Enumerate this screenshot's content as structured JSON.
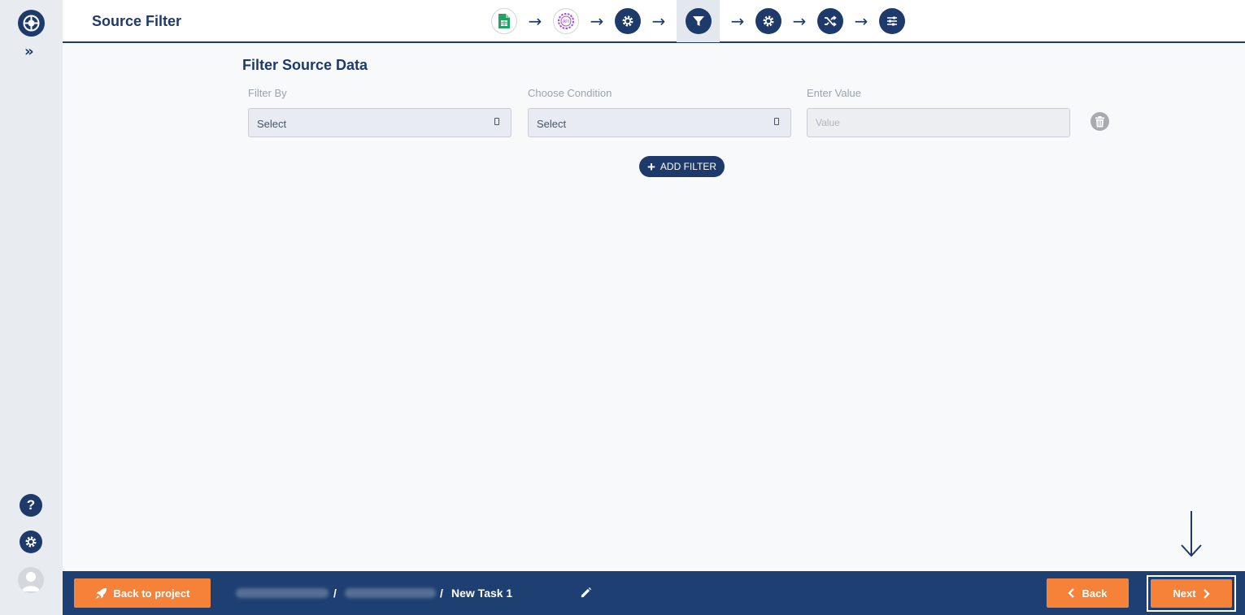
{
  "header": {
    "title": "Source Filter"
  },
  "stepper": {
    "steps": [
      {
        "name": "google-sheets-icon",
        "state": "done"
      },
      {
        "name": "api-icon",
        "state": "done"
      },
      {
        "name": "settings-icon",
        "state": "done"
      },
      {
        "name": "filter-icon",
        "state": "active"
      },
      {
        "name": "settings-icon",
        "state": "pending"
      },
      {
        "name": "shuffle-icon",
        "state": "pending"
      },
      {
        "name": "sliders-icon",
        "state": "pending"
      }
    ],
    "arrow": "→"
  },
  "main": {
    "title": "Filter Source Data",
    "filter_by_label": "Filter By",
    "condition_label": "Choose Condition",
    "value_label": "Enter Value",
    "filter_by_value": "Select",
    "condition_value": "Select",
    "value_placeholder": "Value",
    "add_filter_label": "ADD FILTER",
    "add_filter_plus": "+"
  },
  "sidebar": {
    "expand_label": "»",
    "help_label": "?"
  },
  "footer": {
    "back_to_project_label": "Back to project",
    "separator": "/",
    "task_name": "New Task 1",
    "back_label": "Back",
    "next_label": "Next"
  },
  "colors": {
    "primary": "#1e3a6b",
    "accent": "#f6823a",
    "footer_bg": "#1e3f72"
  }
}
